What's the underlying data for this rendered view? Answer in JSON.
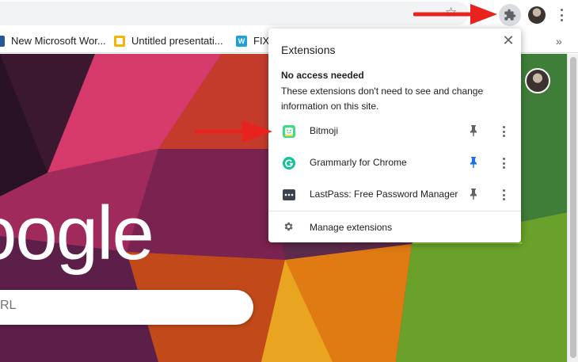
{
  "bookmarks": {
    "items": [
      {
        "label": "New Microsoft Wor...",
        "icon": "word-doc-icon"
      },
      {
        "label": "Untitled presentati...",
        "icon": "slides-icon"
      },
      {
        "label": "FIX",
        "icon": "fix-site-icon"
      }
    ],
    "more_glyph": "»"
  },
  "toolbar": {
    "star_glyph": "☆",
    "icons": [
      "star-icon",
      "extensions-puzzle-icon",
      "profile-avatar",
      "chrome-menu-icon"
    ]
  },
  "ntp": {
    "logo_text": "oogle",
    "search_hint": "RL"
  },
  "extensions_popup": {
    "title": "Extensions",
    "close_glyph": "✕",
    "section_title": "No access needed",
    "section_description": "These extensions don't need to see and change information on this site.",
    "items": [
      {
        "name": "Bitmoji",
        "icon": "bitmoji-icon",
        "pinned": false,
        "icon_color": "#3ddc84"
      },
      {
        "name": "Grammarly for Chrome",
        "icon": "grammarly-icon",
        "pinned": true,
        "icon_color": "#15c39a"
      },
      {
        "name": "LastPass: Free Password Manager",
        "icon": "lastpass-icon",
        "pinned": false,
        "icon_color": "#3c4350"
      }
    ],
    "manage_label": "Manage extensions"
  },
  "colors": {
    "annotation_arrow": "#e8231d",
    "pin_active": "#1a73e8",
    "pin_inactive": "#5f6368"
  }
}
